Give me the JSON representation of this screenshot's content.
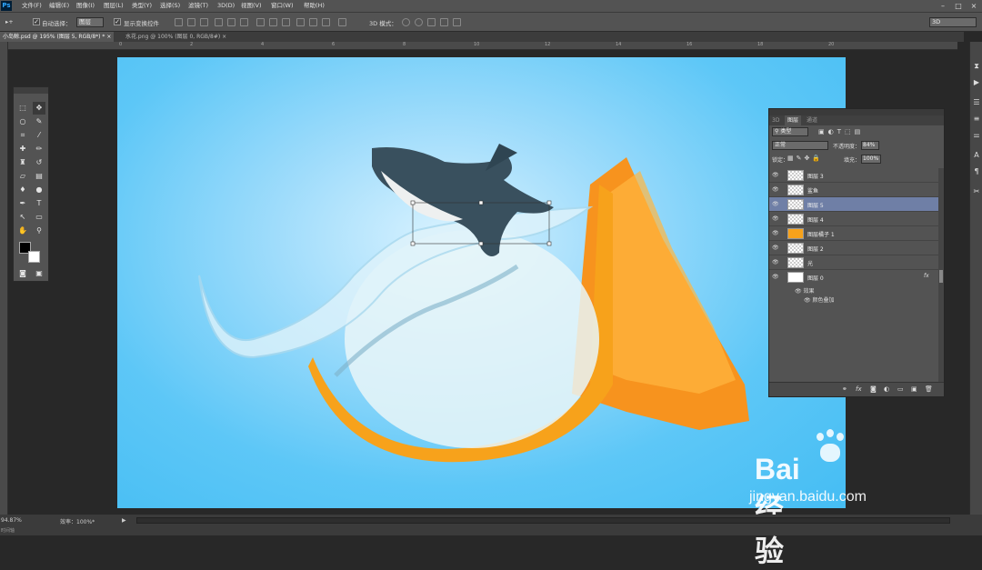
{
  "app": {
    "logo": "Ps"
  },
  "menu": [
    "文件(F)",
    "编辑(E)",
    "图像(I)",
    "图层(L)",
    "类型(Y)",
    "选择(S)",
    "滤镜(T)",
    "3D(D)",
    "视图(V)",
    "窗口(W)",
    "帮助(H)"
  ],
  "options": {
    "auto_select_label": "自动选择：",
    "auto_select_value": "图层",
    "show_transform_label": "显示变换控件",
    "mode_3d_label": "3D 模式：",
    "workspace": "3D"
  },
  "tabs": [
    {
      "label": "小岛鲸.psd @ 195% (图层 5, RGB/8*) *",
      "close": "×"
    },
    {
      "label": "水花.png @ 100% (图层 0, RGB/8#)",
      "close": "×"
    }
  ],
  "ruler_ticks": [
    "0",
    "2",
    "4",
    "6",
    "8",
    "10",
    "12",
    "14",
    "16",
    "18",
    "20"
  ],
  "layers_panel": {
    "tabs": [
      "3D",
      "图层",
      "通道"
    ],
    "filter_kind": "类型",
    "blend_mode": "正常",
    "opacity_label": "不透明度：",
    "opacity_value": "84%",
    "lock_label": "锁定：",
    "fill_label": "填充：",
    "fill_value": "100%",
    "layers": [
      {
        "name": "图层 3",
        "selected": false
      },
      {
        "name": "鲨鱼",
        "selected": false
      },
      {
        "name": "图层 5",
        "selected": true
      },
      {
        "name": "图层 4",
        "selected": false
      },
      {
        "name": "图层橘子 1",
        "selected": false
      },
      {
        "name": "图层 2",
        "selected": false
      },
      {
        "name": "光",
        "selected": false
      },
      {
        "name": "图层 0",
        "selected": false
      }
    ],
    "fx_label": "fx",
    "effects_label": "效果",
    "effect_item": "颜色叠加"
  },
  "status": {
    "zoom": "94.87%",
    "doc": "效率：100%*",
    "mini_label": "时间轴"
  },
  "watermark": {
    "brand": "Bai 经验",
    "url": "jingyan.baidu.com"
  },
  "colors": {
    "canvas_bg": "#45bdf3",
    "orange": "#f7931e",
    "selected_layer": "#6f7fa6"
  }
}
